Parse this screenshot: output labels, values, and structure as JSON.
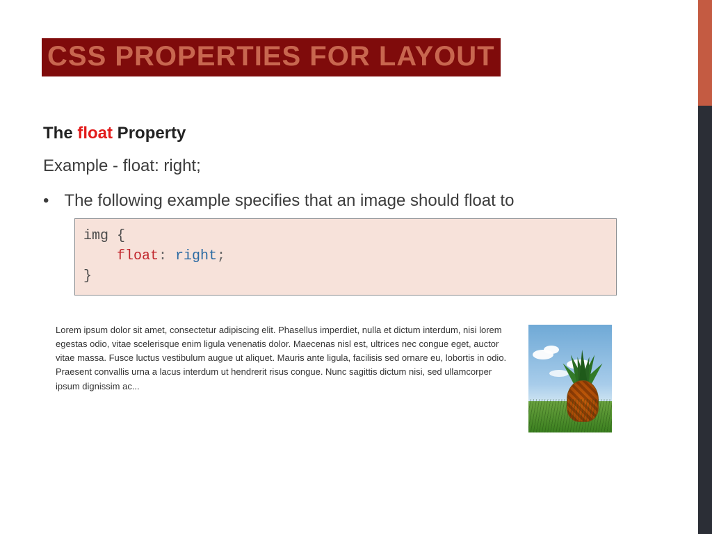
{
  "title": "CSS PROPERTIES FOR LAYOUT",
  "subheading": {
    "before": "The ",
    "keyword": "float",
    "after": " Property"
  },
  "example_line": "Example - float: right;",
  "bullet": "The following example specifies that an image should float to",
  "code": {
    "line1": "img {",
    "prop": "float",
    "colon": ": ",
    "value": "right",
    "semi": ";",
    "line3": "}"
  },
  "demo_paragraph": "Lorem ipsum dolor sit amet, consectetur adipiscing elit. Phasellus imperdiet, nulla et dictum interdum, nisi lorem egestas odio, vitae scelerisque enim ligula venenatis dolor. Maecenas nisl est, ultrices nec congue eget, auctor vitae massa. Fusce luctus vestibulum augue ut aliquet. Mauris ante ligula, facilisis sed ornare eu, lobortis in odio. Praesent convallis urna a lacus interdum ut hendrerit risus congue. Nunc sagittis dictum nisi, sed ullamcorper ipsum dignissim ac..."
}
